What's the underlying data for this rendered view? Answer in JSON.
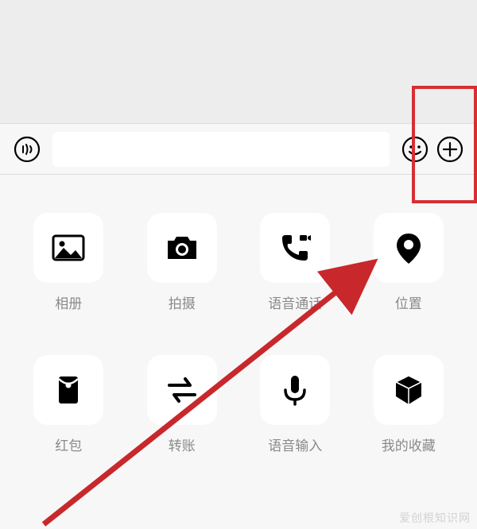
{
  "inputBar": {
    "placeholder": ""
  },
  "panel": {
    "items": [
      {
        "name": "album",
        "label": "相册",
        "icon": "image-icon"
      },
      {
        "name": "camera",
        "label": "拍摄",
        "icon": "camera-icon"
      },
      {
        "name": "voice-call",
        "label": "语音通话",
        "icon": "phone-video-icon"
      },
      {
        "name": "location",
        "label": "位置",
        "icon": "pin-icon"
      },
      {
        "name": "red-packet",
        "label": "红包",
        "icon": "red-packet-icon"
      },
      {
        "name": "transfer",
        "label": "转账",
        "icon": "transfer-icon"
      },
      {
        "name": "voice-input",
        "label": "语音输入",
        "icon": "mic-icon"
      },
      {
        "name": "favorites",
        "label": "我的收藏",
        "icon": "cube-icon"
      }
    ]
  },
  "annotation": {
    "highlight_color": "#d62f33",
    "arrow_color": "#c8282c"
  },
  "watermark": "爱创根知识网"
}
